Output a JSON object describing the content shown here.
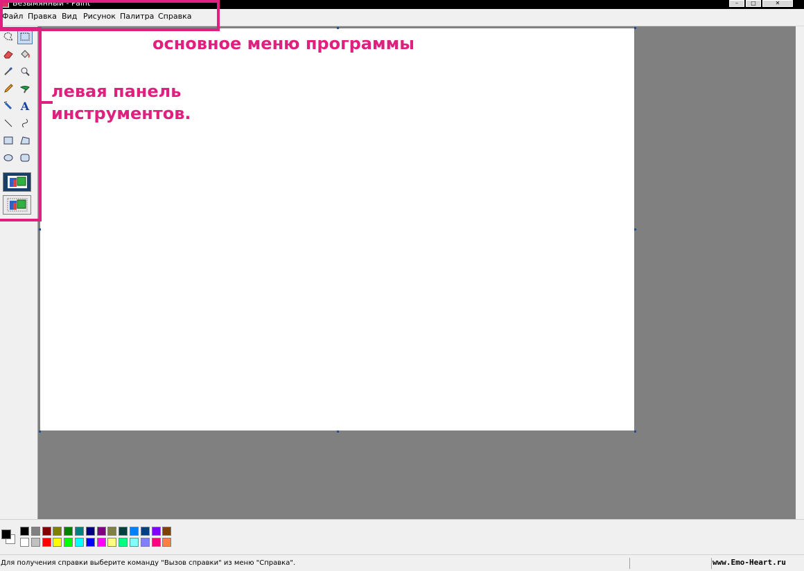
{
  "window": {
    "title": "Безымянный - Paint",
    "buttons": {
      "minimize": "–",
      "maximize": "□",
      "close": "✕"
    }
  },
  "menu": {
    "items": [
      "Файл",
      "Правка",
      "Вид",
      "Рисунок",
      "Палитра",
      "Справка"
    ]
  },
  "toolbox": {
    "tools": [
      {
        "name": "free-select-icon",
        "selected": false
      },
      {
        "name": "rect-select-icon",
        "selected": true
      },
      {
        "name": "eraser-icon",
        "selected": false
      },
      {
        "name": "fill-icon",
        "selected": false
      },
      {
        "name": "color-picker-icon",
        "selected": false
      },
      {
        "name": "magnifier-icon",
        "selected": false
      },
      {
        "name": "pencil-icon",
        "selected": false
      },
      {
        "name": "brush-icon",
        "selected": false
      },
      {
        "name": "airbrush-icon",
        "selected": false
      },
      {
        "name": "text-icon",
        "selected": false
      },
      {
        "name": "line-icon",
        "selected": false
      },
      {
        "name": "curve-icon",
        "selected": false
      },
      {
        "name": "rectangle-icon",
        "selected": false
      },
      {
        "name": "polygon-icon",
        "selected": false
      },
      {
        "name": "ellipse-icon",
        "selected": false
      },
      {
        "name": "rounded-rectangle-icon",
        "selected": false
      }
    ],
    "text_tool_glyph": "A",
    "options": [
      {
        "name": "opaque-selection-icon",
        "active": true
      },
      {
        "name": "transparent-selection-icon",
        "active": false
      }
    ]
  },
  "palette": {
    "foreground": "#000000",
    "background": "#ffffff",
    "colors_top": [
      "#000000",
      "#808080",
      "#800000",
      "#808000",
      "#008000",
      "#008080",
      "#000080",
      "#800080",
      "#808040",
      "#004040",
      "#0080ff",
      "#004080",
      "#8000ff",
      "#804000"
    ],
    "colors_bottom": [
      "#ffffff",
      "#c0c0c0",
      "#ff0000",
      "#ffff00",
      "#00ff00",
      "#00ffff",
      "#0000ff",
      "#ff00ff",
      "#ffff80",
      "#00ff80",
      "#80ffff",
      "#8080ff",
      "#ff0080",
      "#ff8040"
    ]
  },
  "statusbar": {
    "help_text": "Для получения справки выберите команду \"Вызов справки\" из меню \"Справка\".",
    "watermark": "www.Emo-Heart.ru"
  },
  "annotations": {
    "menu_label": "основное меню программы",
    "tools_label_line1": "левая панель",
    "tools_label_line2": "инструментов.",
    "color": "#e0207e"
  }
}
